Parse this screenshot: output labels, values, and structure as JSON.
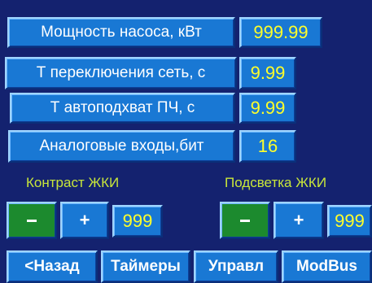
{
  "params": [
    {
      "label": "Мощность насоса, кВт",
      "value": "999.99"
    },
    {
      "label": "Т переключения сеть, с",
      "value": "9.99"
    },
    {
      "label": "Т автоподхват ПЧ, с",
      "value": "9.99"
    },
    {
      "label": "Аналоговые входы,бит",
      "value": "16"
    }
  ],
  "contrast": {
    "label": "Контраст ЖКИ",
    "minus": "-",
    "plus": "+",
    "value": "999"
  },
  "backlight": {
    "label": "Подсветка ЖКИ",
    "minus": "-",
    "plus": "+",
    "value": "999"
  },
  "nav": {
    "back": "<Назад",
    "timers": "Таймеры",
    "control": "Управл",
    "modbus": "ModBus"
  },
  "colors": {
    "panel": "#14226f",
    "button": "#1978d4",
    "minus_button": "#1c8a2e",
    "value_text": "#ffff2a",
    "section_label": "#c8e63a"
  }
}
